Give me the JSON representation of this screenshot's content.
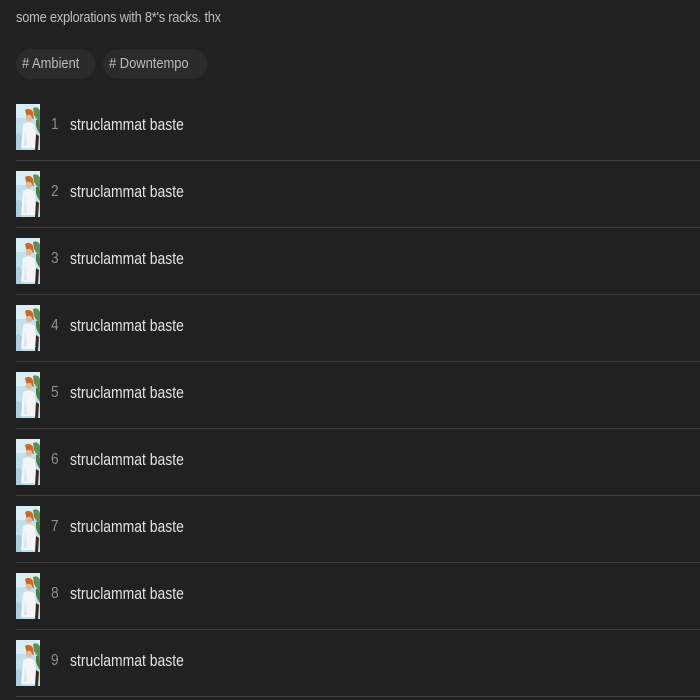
{
  "release": {
    "description": "some explorations with 8*'s racks. thx"
  },
  "tags": [
    {
      "label": "# Ambient"
    },
    {
      "label": "# Downtempo"
    }
  ],
  "tracks": [
    {
      "number": "1",
      "title": "struclammat baste",
      "cover_icon": "album-art-thumbnail"
    },
    {
      "number": "2",
      "title": "struclammat baste",
      "cover_icon": "album-art-thumbnail"
    },
    {
      "number": "3",
      "title": "struclammat baste",
      "cover_icon": "album-art-thumbnail"
    },
    {
      "number": "4",
      "title": "struclammat baste",
      "cover_icon": "album-art-thumbnail"
    },
    {
      "number": "5",
      "title": "struclammat baste",
      "cover_icon": "album-art-thumbnail"
    },
    {
      "number": "6",
      "title": "struclammat baste",
      "cover_icon": "album-art-thumbnail"
    },
    {
      "number": "7",
      "title": "struclammat baste",
      "cover_icon": "album-art-thumbnail"
    },
    {
      "number": "8",
      "title": "struclammat baste",
      "cover_icon": "album-art-thumbnail"
    },
    {
      "number": "9",
      "title": "struclammat baste",
      "cover_icon": "album-art-thumbnail"
    }
  ],
  "colors": {
    "background": "#212121",
    "tag_background": "#2b2b2b",
    "divider": "#3f3f3f",
    "text_primary": "#e2e2e2",
    "text_muted": "#8d8d8d"
  }
}
